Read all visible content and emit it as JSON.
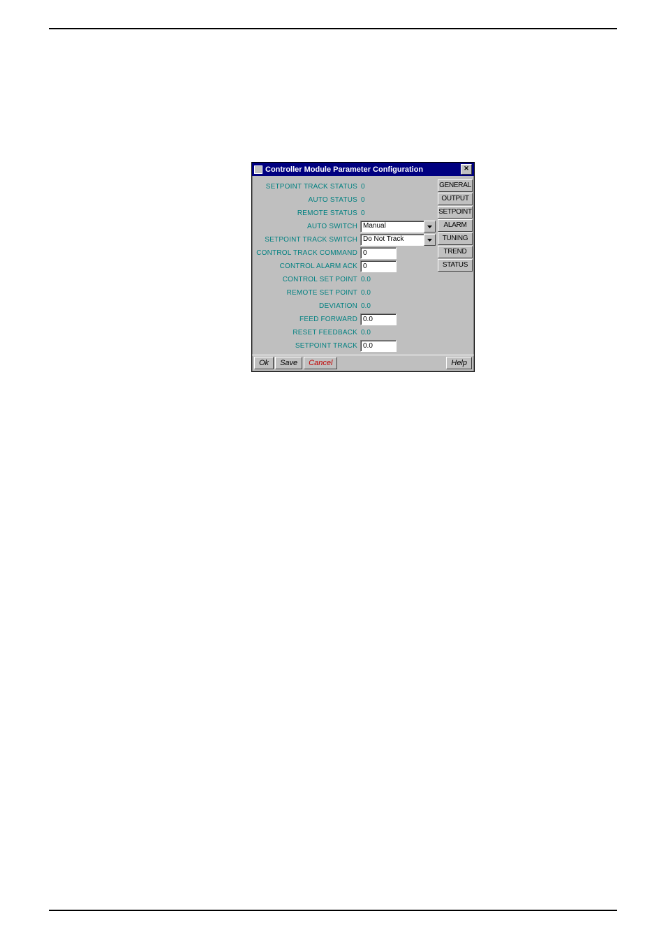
{
  "dialog": {
    "title": "Controller Module Parameter Configuration"
  },
  "fields": {
    "setpoint_track_status": {
      "label": "SETPOINT TRACK STATUS",
      "value": "0"
    },
    "auto_status": {
      "label": "AUTO STATUS",
      "value": "0"
    },
    "remote_status": {
      "label": "REMOTE STATUS",
      "value": "0"
    },
    "auto_switch": {
      "label": "AUTO SWITCH",
      "value": "Manual"
    },
    "setpoint_track_switch": {
      "label": "SETPOINT TRACK SWITCH",
      "value": "Do Not Track"
    },
    "control_track_command": {
      "label": "CONTROL TRACK COMMAND",
      "value": "0"
    },
    "control_alarm_ack": {
      "label": "CONTROL ALARM ACK",
      "value": "0"
    },
    "control_set_point": {
      "label": "CONTROL SET POINT",
      "value": "0.0"
    },
    "remote_set_point": {
      "label": "REMOTE SET POINT",
      "value": "0.0"
    },
    "deviation": {
      "label": "DEVIATION",
      "value": "0.0"
    },
    "feed_forward": {
      "label": "FEED FORWARD",
      "value": "0.0"
    },
    "reset_feedback": {
      "label": "RESET FEEDBACK",
      "value": "0.0"
    },
    "setpoint_track": {
      "label": "SETPOINT TRACK",
      "value": "0.0"
    }
  },
  "side_buttons": {
    "general": "GENERAL",
    "output": "OUTPUT",
    "setpoint": "SETPOINT",
    "alarm": "ALARM",
    "tuning": "TUNING",
    "trend": "TREND",
    "status": "STATUS"
  },
  "bottom_buttons": {
    "ok": "Ok",
    "save": "Save",
    "cancel": "Cancel",
    "help": "Help"
  }
}
